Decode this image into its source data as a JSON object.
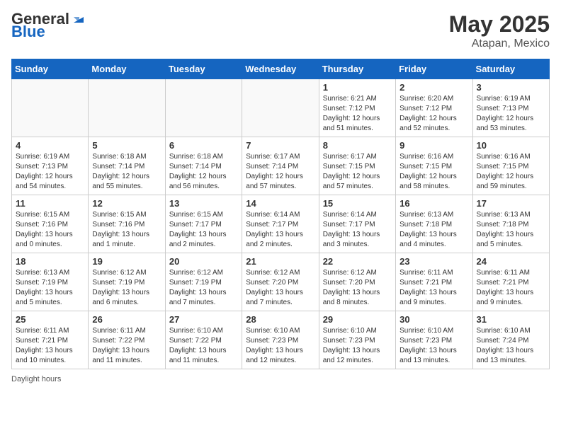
{
  "header": {
    "logo_general": "General",
    "logo_blue": "Blue",
    "month_year": "May 2025",
    "location": "Atapan, Mexico"
  },
  "days_of_week": [
    "Sunday",
    "Monday",
    "Tuesday",
    "Wednesday",
    "Thursday",
    "Friday",
    "Saturday"
  ],
  "weeks": [
    [
      {
        "day": "",
        "info": ""
      },
      {
        "day": "",
        "info": ""
      },
      {
        "day": "",
        "info": ""
      },
      {
        "day": "",
        "info": ""
      },
      {
        "day": "1",
        "info": "Sunrise: 6:21 AM\nSunset: 7:12 PM\nDaylight: 12 hours\nand 51 minutes."
      },
      {
        "day": "2",
        "info": "Sunrise: 6:20 AM\nSunset: 7:12 PM\nDaylight: 12 hours\nand 52 minutes."
      },
      {
        "day": "3",
        "info": "Sunrise: 6:19 AM\nSunset: 7:13 PM\nDaylight: 12 hours\nand 53 minutes."
      }
    ],
    [
      {
        "day": "4",
        "info": "Sunrise: 6:19 AM\nSunset: 7:13 PM\nDaylight: 12 hours\nand 54 minutes."
      },
      {
        "day": "5",
        "info": "Sunrise: 6:18 AM\nSunset: 7:14 PM\nDaylight: 12 hours\nand 55 minutes."
      },
      {
        "day": "6",
        "info": "Sunrise: 6:18 AM\nSunset: 7:14 PM\nDaylight: 12 hours\nand 56 minutes."
      },
      {
        "day": "7",
        "info": "Sunrise: 6:17 AM\nSunset: 7:14 PM\nDaylight: 12 hours\nand 57 minutes."
      },
      {
        "day": "8",
        "info": "Sunrise: 6:17 AM\nSunset: 7:15 PM\nDaylight: 12 hours\nand 57 minutes."
      },
      {
        "day": "9",
        "info": "Sunrise: 6:16 AM\nSunset: 7:15 PM\nDaylight: 12 hours\nand 58 minutes."
      },
      {
        "day": "10",
        "info": "Sunrise: 6:16 AM\nSunset: 7:15 PM\nDaylight: 12 hours\nand 59 minutes."
      }
    ],
    [
      {
        "day": "11",
        "info": "Sunrise: 6:15 AM\nSunset: 7:16 PM\nDaylight: 13 hours\nand 0 minutes."
      },
      {
        "day": "12",
        "info": "Sunrise: 6:15 AM\nSunset: 7:16 PM\nDaylight: 13 hours\nand 1 minute."
      },
      {
        "day": "13",
        "info": "Sunrise: 6:15 AM\nSunset: 7:17 PM\nDaylight: 13 hours\nand 2 minutes."
      },
      {
        "day": "14",
        "info": "Sunrise: 6:14 AM\nSunset: 7:17 PM\nDaylight: 13 hours\nand 2 minutes."
      },
      {
        "day": "15",
        "info": "Sunrise: 6:14 AM\nSunset: 7:17 PM\nDaylight: 13 hours\nand 3 minutes."
      },
      {
        "day": "16",
        "info": "Sunrise: 6:13 AM\nSunset: 7:18 PM\nDaylight: 13 hours\nand 4 minutes."
      },
      {
        "day": "17",
        "info": "Sunrise: 6:13 AM\nSunset: 7:18 PM\nDaylight: 13 hours\nand 5 minutes."
      }
    ],
    [
      {
        "day": "18",
        "info": "Sunrise: 6:13 AM\nSunset: 7:19 PM\nDaylight: 13 hours\nand 5 minutes."
      },
      {
        "day": "19",
        "info": "Sunrise: 6:12 AM\nSunset: 7:19 PM\nDaylight: 13 hours\nand 6 minutes."
      },
      {
        "day": "20",
        "info": "Sunrise: 6:12 AM\nSunset: 7:19 PM\nDaylight: 13 hours\nand 7 minutes."
      },
      {
        "day": "21",
        "info": "Sunrise: 6:12 AM\nSunset: 7:20 PM\nDaylight: 13 hours\nand 7 minutes."
      },
      {
        "day": "22",
        "info": "Sunrise: 6:12 AM\nSunset: 7:20 PM\nDaylight: 13 hours\nand 8 minutes."
      },
      {
        "day": "23",
        "info": "Sunrise: 6:11 AM\nSunset: 7:21 PM\nDaylight: 13 hours\nand 9 minutes."
      },
      {
        "day": "24",
        "info": "Sunrise: 6:11 AM\nSunset: 7:21 PM\nDaylight: 13 hours\nand 9 minutes."
      }
    ],
    [
      {
        "day": "25",
        "info": "Sunrise: 6:11 AM\nSunset: 7:21 PM\nDaylight: 13 hours\nand 10 minutes."
      },
      {
        "day": "26",
        "info": "Sunrise: 6:11 AM\nSunset: 7:22 PM\nDaylight: 13 hours\nand 11 minutes."
      },
      {
        "day": "27",
        "info": "Sunrise: 6:10 AM\nSunset: 7:22 PM\nDaylight: 13 hours\nand 11 minutes."
      },
      {
        "day": "28",
        "info": "Sunrise: 6:10 AM\nSunset: 7:23 PM\nDaylight: 13 hours\nand 12 minutes."
      },
      {
        "day": "29",
        "info": "Sunrise: 6:10 AM\nSunset: 7:23 PM\nDaylight: 13 hours\nand 12 minutes."
      },
      {
        "day": "30",
        "info": "Sunrise: 6:10 AM\nSunset: 7:23 PM\nDaylight: 13 hours\nand 13 minutes."
      },
      {
        "day": "31",
        "info": "Sunrise: 6:10 AM\nSunset: 7:24 PM\nDaylight: 13 hours\nand 13 minutes."
      }
    ]
  ],
  "footer": {
    "daylight_hours_label": "Daylight hours"
  }
}
